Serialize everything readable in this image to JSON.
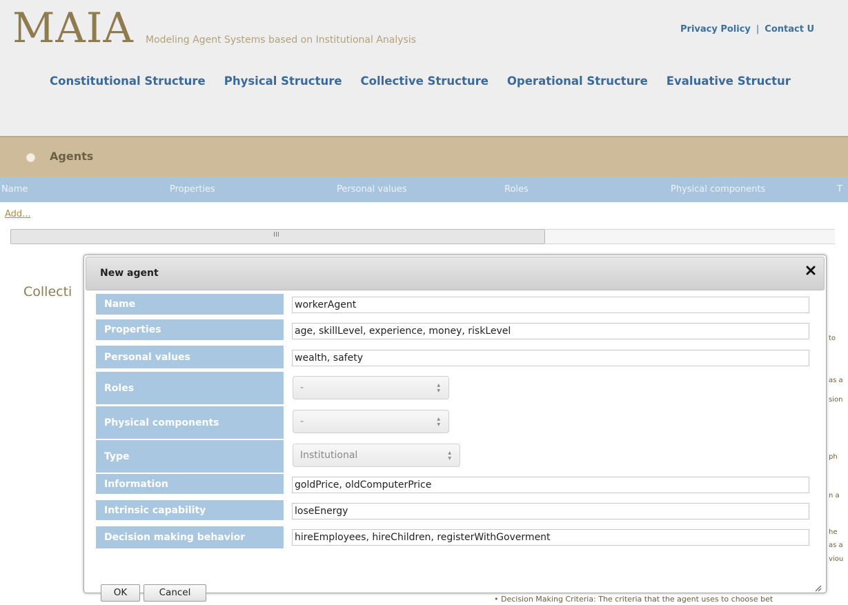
{
  "header": {
    "logo": "MAIA",
    "tagline": "Modeling Agent Systems based on Institutional Analysis",
    "links": [
      "Privacy Policy",
      "Contact U"
    ],
    "link_separator": "|",
    "nav": [
      "Constitutional Structure",
      "Physical Structure",
      "Collective Structure",
      "Operational Structure",
      "Evaluative Structur"
    ]
  },
  "agents_section": {
    "title": "Agents",
    "columns": [
      "Name",
      "Properties",
      "Personal values",
      "Roles",
      "Physical components",
      "T"
    ],
    "add_link": "Add...",
    "scroll_grip": "III"
  },
  "background": {
    "collection_heading": "Collecti",
    "right_fragments": [
      "to",
      "as a",
      "sion",
      "ph",
      "n a",
      "he",
      "as a",
      "viou"
    ],
    "bottom_text": "•  Decision Making Criteria: The criteria that the agent uses to choose bet"
  },
  "modal": {
    "title": "New agent",
    "close_icon": "close-icon",
    "fields": [
      {
        "label": "Name",
        "kind": "text",
        "value": "workerAgent"
      },
      {
        "label": "Properties",
        "kind": "text",
        "value": "age, skillLevel, experience, money, riskLevel"
      },
      {
        "label": "Personal values",
        "kind": "text",
        "value": "wealth, safety"
      },
      {
        "label": "Roles",
        "kind": "select",
        "value": "-"
      },
      {
        "label": "Physical components",
        "kind": "select",
        "value": "-"
      },
      {
        "label": "Type",
        "kind": "select",
        "value": "Institutional"
      },
      {
        "label": "Information",
        "kind": "text",
        "value": "goldPrice, oldComputerPrice"
      },
      {
        "label": "Intrinsic capability",
        "kind": "text",
        "value": "loseEnergy"
      },
      {
        "label": "Decision making behavior",
        "kind": "text",
        "value": "hireEmployees, hireChildren, registerWithGoverment"
      }
    ],
    "ok_label": "OK",
    "cancel_label": "Cancel"
  },
  "colors": {
    "logo": "#8f7c4e",
    "nav": "#3b6a9a",
    "agents_bar": "#cdbb9a",
    "column_header": "#a9c4de",
    "field_label_bg": "#a9c7e1"
  }
}
